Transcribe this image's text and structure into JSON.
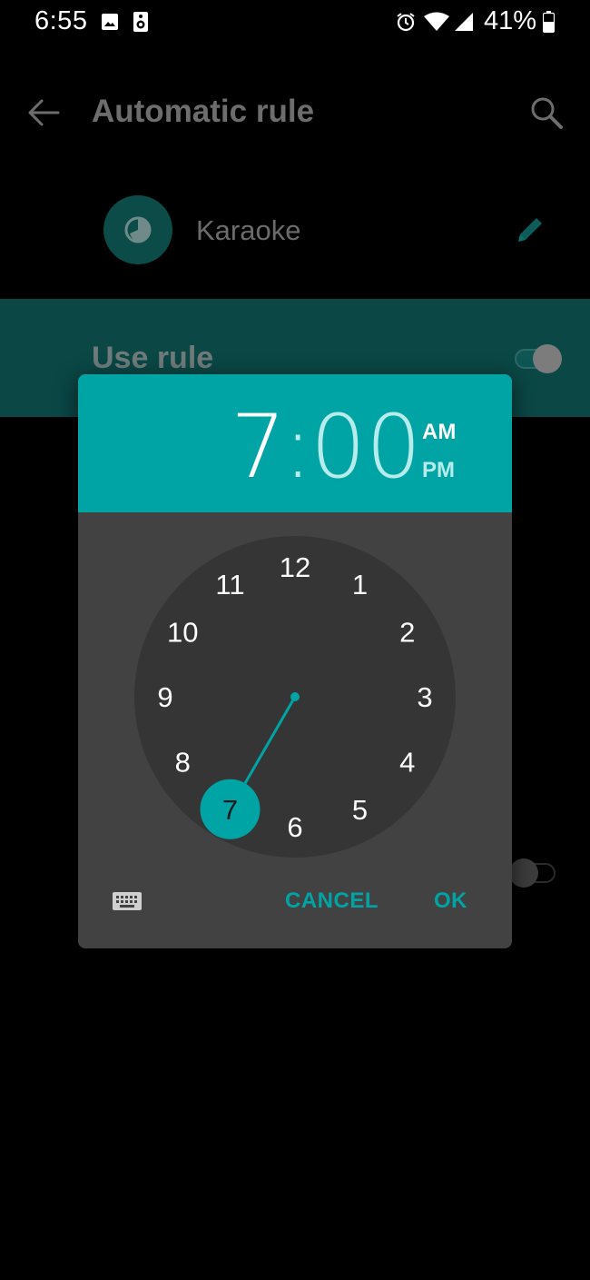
{
  "status_bar": {
    "time": "6:55",
    "battery_percent": "41%",
    "icons": [
      "image-icon",
      "speaker-icon",
      "alarm-icon",
      "wifi-icon",
      "signal-icon",
      "battery-icon"
    ]
  },
  "app_bar": {
    "title": "Automatic rule",
    "back_icon": "back-arrow-icon",
    "search_icon": "search-icon"
  },
  "rule": {
    "name": "Karaoke",
    "icon": "clock-rule-icon",
    "edit_icon": "pencil-icon"
  },
  "use_rule": {
    "label": "Use rule",
    "enabled": true
  },
  "time_picker": {
    "hour": "7",
    "separator": ":",
    "minute": "00",
    "am_label": "AM",
    "pm_label": "PM",
    "selected_period": "AM",
    "dial_numbers": [
      "12",
      "1",
      "2",
      "3",
      "4",
      "5",
      "6",
      "7",
      "8",
      "9",
      "10",
      "11"
    ],
    "selected_number": "7",
    "keyboard_icon": "keyboard-icon",
    "cancel_label": "CANCEL",
    "ok_label": "OK"
  },
  "colors": {
    "accent": "#00a4a5",
    "accent_light": "#b6eceb",
    "dialog_bg": "#424242",
    "dial_bg": "#353535",
    "band_bg": "#0a4745"
  }
}
